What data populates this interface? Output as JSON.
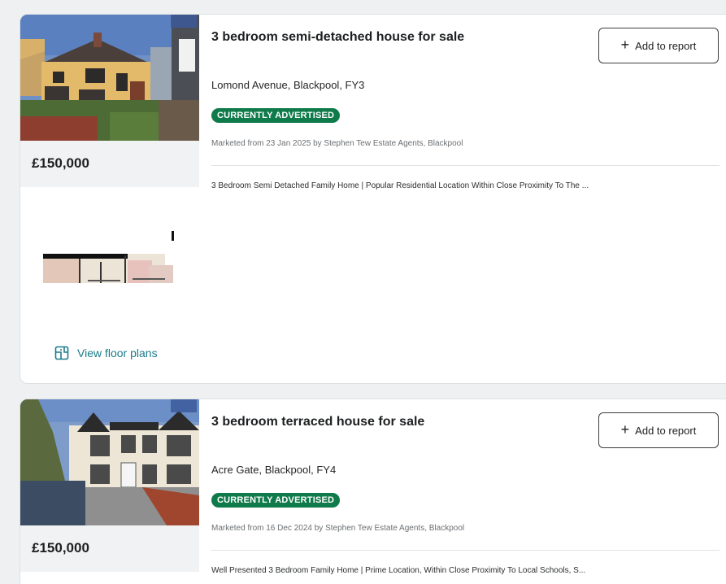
{
  "listings": [
    {
      "price": "£150,000",
      "title": "3 bedroom semi-detached house for sale",
      "address": "Lomond Avenue, Blackpool, FY3",
      "badge": "CURRENTLY ADVERTISED",
      "marketed": "Marketed from 23 Jan 2025 by Stephen Tew Estate Agents, Blackpool",
      "summary": "3 Bedroom Semi Detached Family Home | Popular Residential Location Within Close Proximity To The ...",
      "add_label": "Add to report",
      "floor_plans_label": "View floor plans",
      "icons": {
        "add": "plus-icon",
        "floorplan": "floor-plan-icon"
      }
    },
    {
      "price": "£150,000",
      "title": "3 bedroom terraced house for sale",
      "address": "Acre Gate, Blackpool, FY4",
      "badge": "CURRENTLY ADVERTISED",
      "marketed": "Marketed from 16 Dec 2024 by Stephen Tew Estate Agents, Blackpool",
      "summary": "Well Presented 3 Bedroom Family Home | Prime Location, Within Close Proximity To Local Schools, S...",
      "add_label": "Add to report",
      "icons": {
        "add": "plus-icon"
      }
    }
  ],
  "colors": {
    "badge": "#0f7a4a",
    "link": "#1a7b8a",
    "page_bg": "#eef0f1",
    "price_bg": "#f1f2f3"
  }
}
